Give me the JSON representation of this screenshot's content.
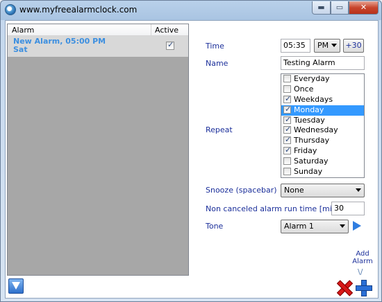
{
  "window": {
    "title": "www.myfreealarmclock.com",
    "min_glyph": "▬",
    "max_glyph": "▭",
    "close_glyph": "✕"
  },
  "alarm_list": {
    "columns": [
      "Alarm",
      "Active"
    ],
    "rows": [
      {
        "name": "New Alarm, 05:00 PM\nSat",
        "active": true
      }
    ]
  },
  "form": {
    "time_label": "Time",
    "time_value": "05:35",
    "ampm_value": "PM",
    "plus30_label": "+30",
    "name_label": "Name",
    "name_value": "Testing Alarm",
    "repeat_label": "Repeat",
    "repeat_items": [
      {
        "label": "Everyday",
        "checked": false,
        "selected": false
      },
      {
        "label": "Once",
        "checked": false,
        "selected": false
      },
      {
        "label": "Weekdays",
        "checked": true,
        "selected": false
      },
      {
        "label": "Monday",
        "checked": true,
        "selected": true
      },
      {
        "label": "Tuesday",
        "checked": true,
        "selected": false
      },
      {
        "label": "Wednesday",
        "checked": true,
        "selected": false
      },
      {
        "label": "Thursday",
        "checked": true,
        "selected": false
      },
      {
        "label": "Friday",
        "checked": true,
        "selected": false
      },
      {
        "label": "Saturday",
        "checked": false,
        "selected": false
      },
      {
        "label": "Sunday",
        "checked": false,
        "selected": false
      }
    ],
    "snooze_label": "Snooze (spacebar)",
    "snooze_value": "None",
    "run_time_label": "Non canceled alarm run time [min]",
    "run_time_value": "30",
    "tone_label": "Tone",
    "tone_value": "Alarm 1"
  },
  "actions": {
    "add_alarm_label": "Add\nAlarm",
    "chevron": "\\/"
  }
}
